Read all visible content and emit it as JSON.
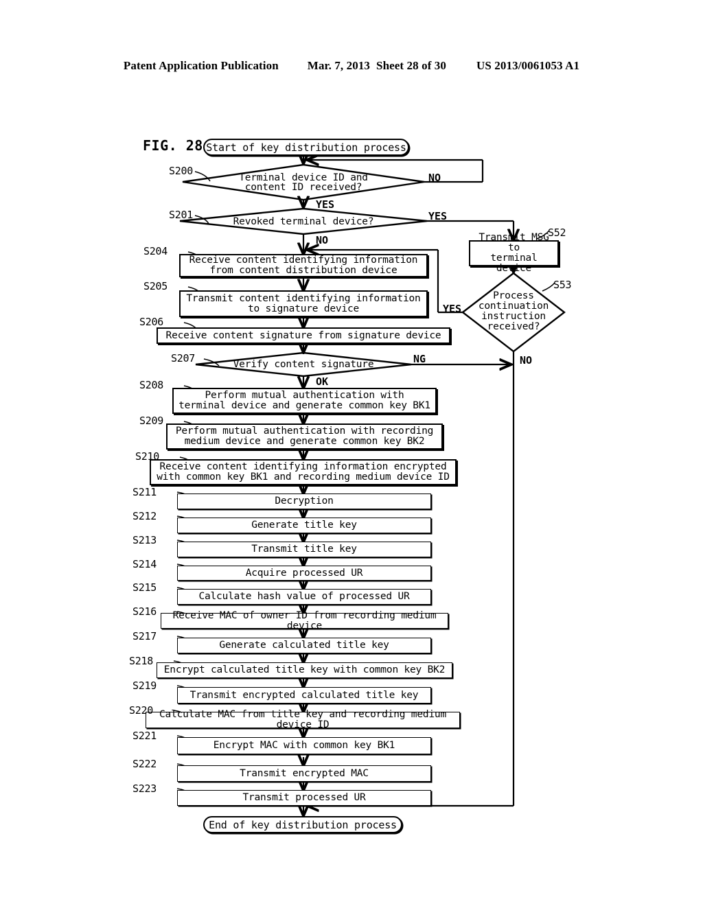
{
  "header": {
    "left": "Patent Application Publication",
    "date": "Mar. 7, 2013",
    "sheet": "Sheet 28 of 30",
    "number": "US 2013/0061053 A1"
  },
  "figure": {
    "label": "FIG. 28"
  },
  "nodes": {
    "start": {
      "id": "",
      "text": "Start of key distribution process"
    },
    "s200": {
      "id": "S200",
      "text": "Terminal device ID and\ncontent ID received?"
    },
    "s201": {
      "id": "S201",
      "text": "Revoked terminal device?"
    },
    "s204": {
      "id": "S204",
      "text": "Receive content identifying information\nfrom content distribution device"
    },
    "s205": {
      "id": "S205",
      "text": "Transmit content identifying information\nto signature device"
    },
    "s206": {
      "id": "S206",
      "text": "Receive content signature from signature device"
    },
    "s207": {
      "id": "S207",
      "text": "Verify content signature"
    },
    "s208": {
      "id": "S208",
      "text": "Perform mutual authentication with\nterminal device and generate common key BK1"
    },
    "s209": {
      "id": "S209",
      "text": "Perform mutual authentication with recording\nmedium device and generate common key BK2"
    },
    "s210": {
      "id": "S210",
      "text": "Receive content identifying information encrypted\nwith common key BK1 and recording medium device ID"
    },
    "s211": {
      "id": "S211",
      "text": "Decryption"
    },
    "s212": {
      "id": "S212",
      "text": "Generate title key"
    },
    "s213": {
      "id": "S213",
      "text": "Transmit title key"
    },
    "s214": {
      "id": "S214",
      "text": "Acquire processed UR"
    },
    "s215": {
      "id": "S215",
      "text": "Calculate hash value of processed UR"
    },
    "s216": {
      "id": "S216",
      "text": "Receive MAC of owner ID from recording medium device"
    },
    "s217": {
      "id": "S217",
      "text": "Generate calculated title key"
    },
    "s218": {
      "id": "S218",
      "text": "Encrypt calculated title key with common key BK2"
    },
    "s219": {
      "id": "S219",
      "text": "Transmit encrypted calculated title key"
    },
    "s220": {
      "id": "S220",
      "text": "Calculate MAC from title key and recording medium device ID"
    },
    "s221": {
      "id": "S221",
      "text": "Encrypt MAC with common key BK1"
    },
    "s222": {
      "id": "S222",
      "text": "Transmit encrypted MAC"
    },
    "s223": {
      "id": "S223",
      "text": "Transmit processed UR"
    },
    "s52": {
      "id": "S52",
      "text": "Transmit MSG to\nterminal device"
    },
    "s53": {
      "id": "S53",
      "text": "Process\ncontinuation\ninstruction\nreceived?"
    },
    "end": {
      "id": "",
      "text": "End of key distribution process"
    }
  },
  "branches": {
    "s200_no": "NO",
    "s200_yes": "YES",
    "s201_yes": "YES",
    "s201_no": "NO",
    "s207_ng": "NG",
    "s207_ok": "OK",
    "s53_yes": "YES",
    "s53_no": "NO"
  },
  "colors": {
    "ink": "#000000",
    "paper": "#ffffff"
  }
}
